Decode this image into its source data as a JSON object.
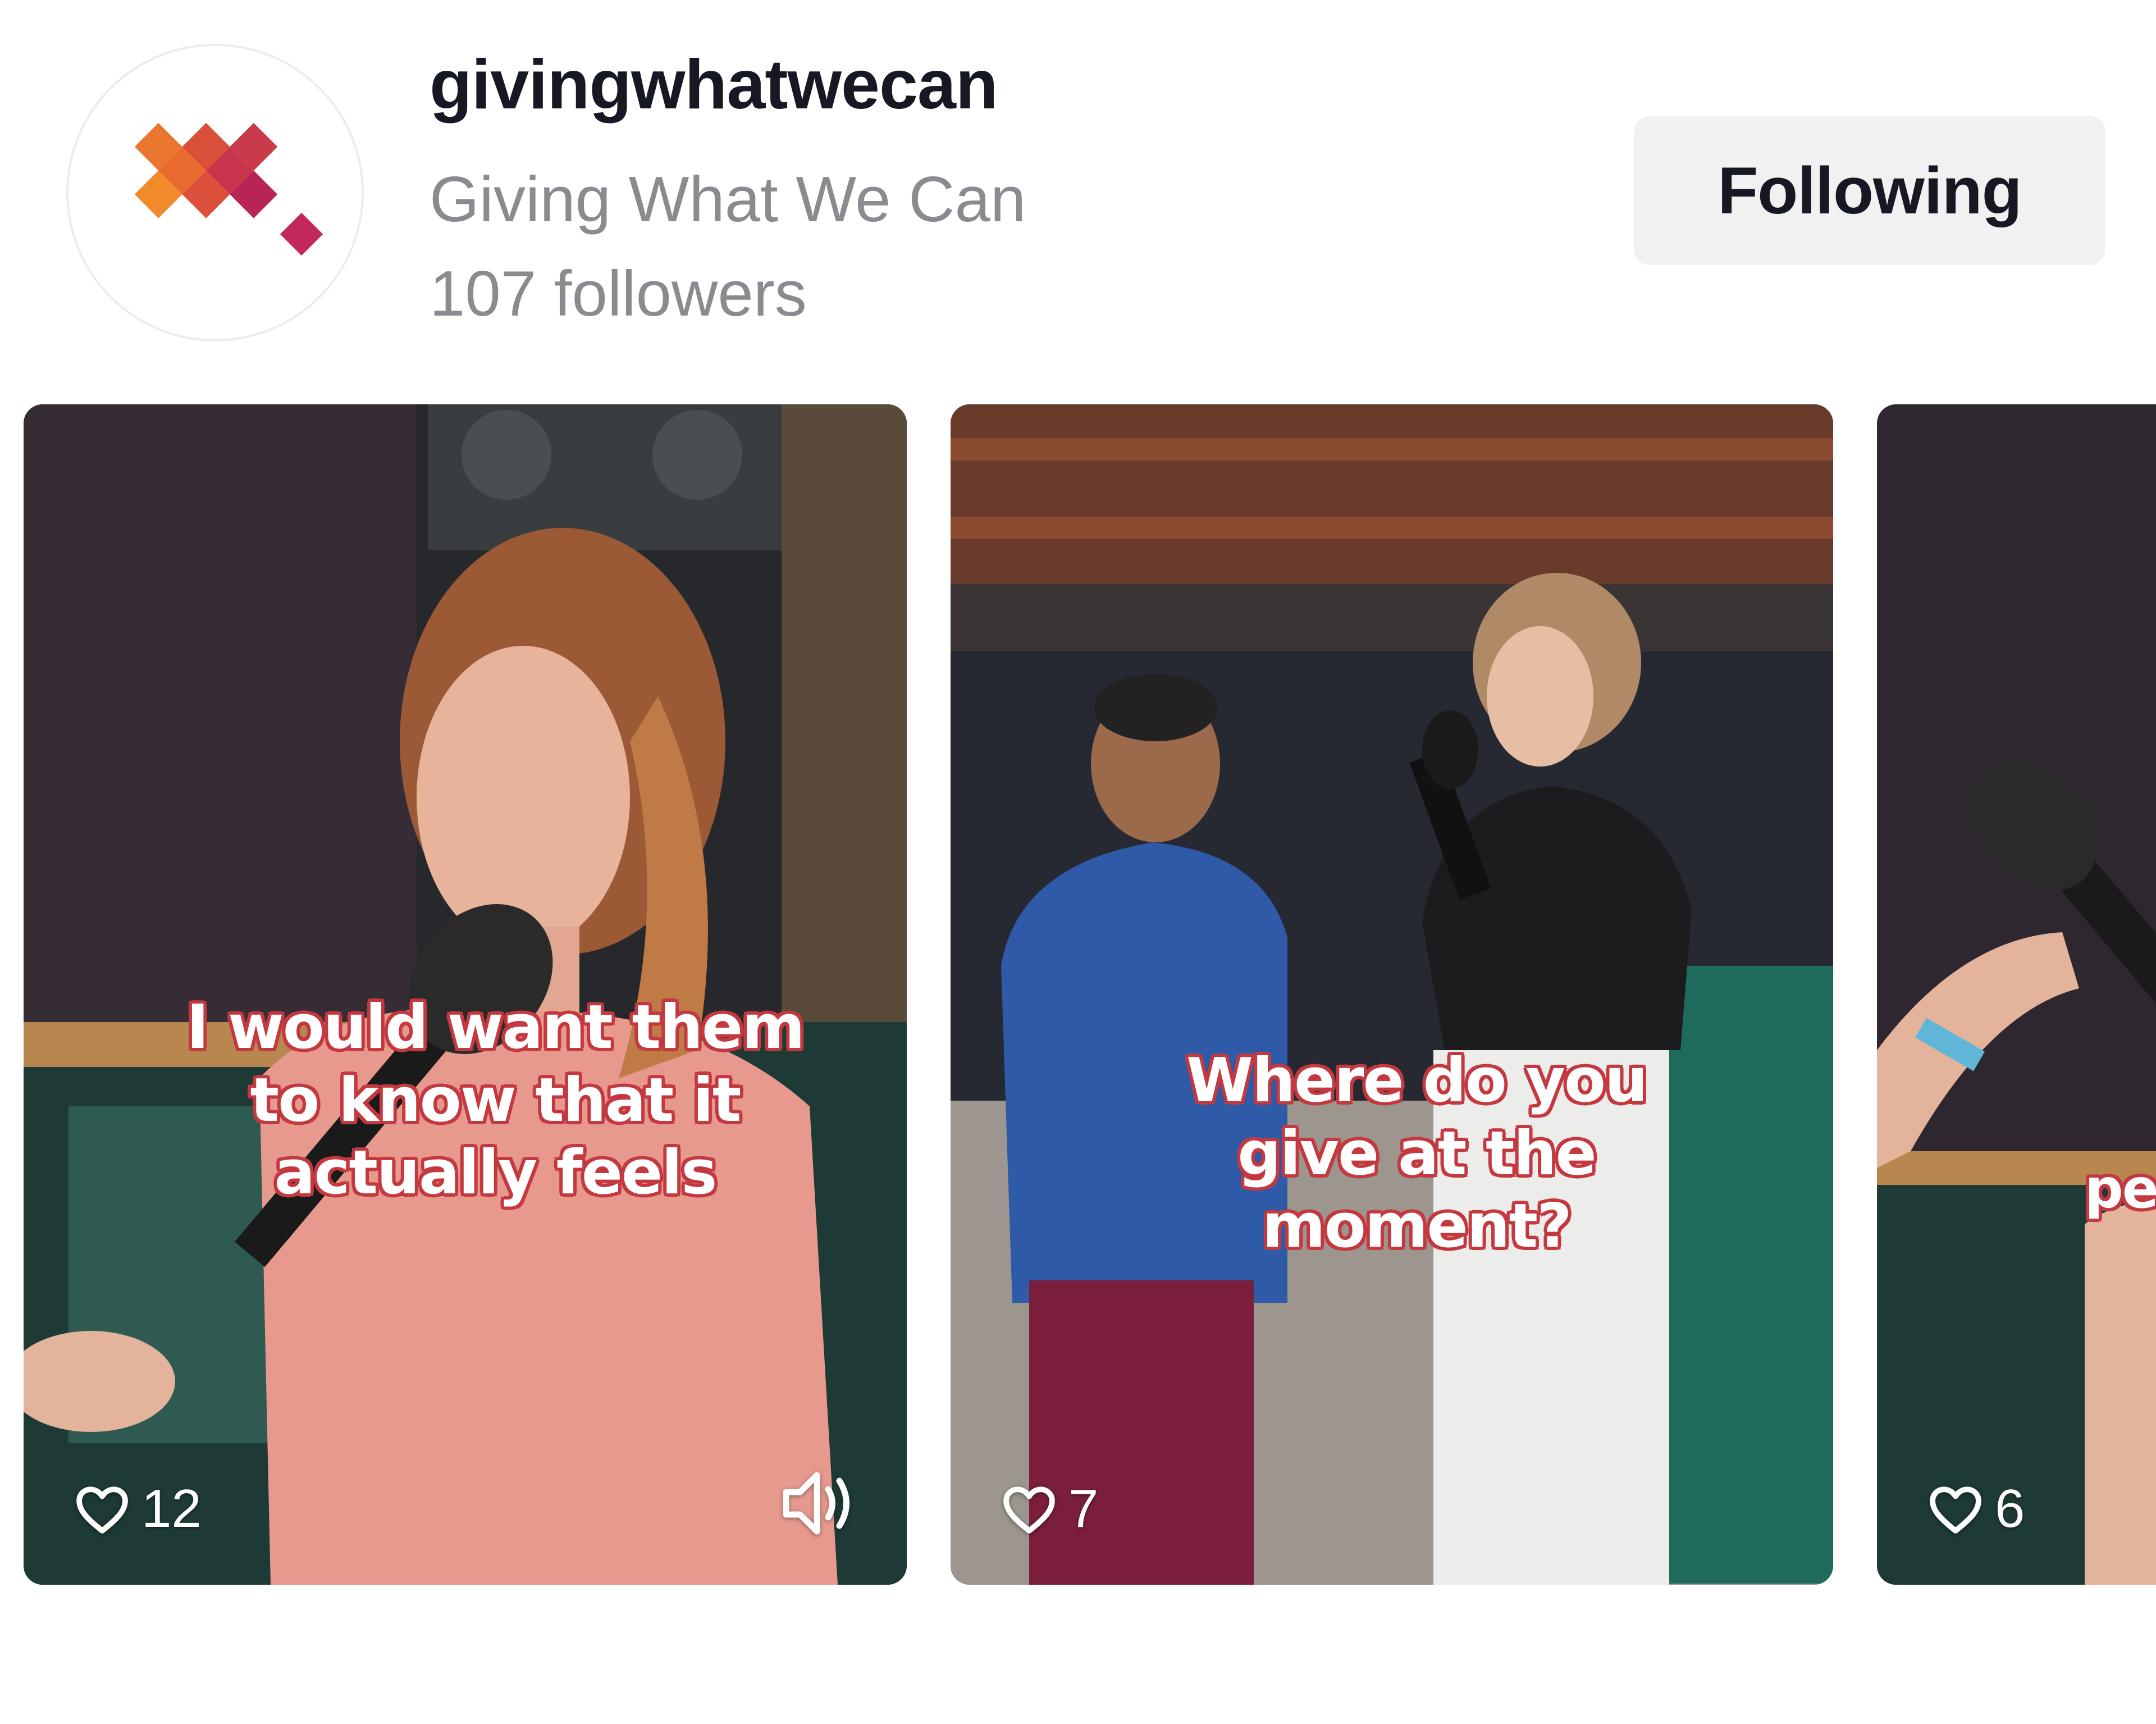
{
  "profile": {
    "username": "givingwhatwecan",
    "display_name": "Giving What We Can",
    "followers": "107 followers",
    "follow_button_label": "Following",
    "avatar_icon": "heart-logo-icon",
    "brand_colors": [
      "#c2285a",
      "#e35a2c",
      "#f0882a"
    ]
  },
  "videos": [
    {
      "caption": "I would want them to know that it actually feels",
      "likes": "12",
      "has_sound_icon": true
    },
    {
      "caption": "Where do you give at the moment?",
      "likes": "7"
    },
    {
      "caption": "pe",
      "likes": "6"
    }
  ],
  "colors": {
    "caption_outline": "#c4383f",
    "button_bg": "#f1f1f2",
    "secondary_text": "#8a8b91"
  }
}
